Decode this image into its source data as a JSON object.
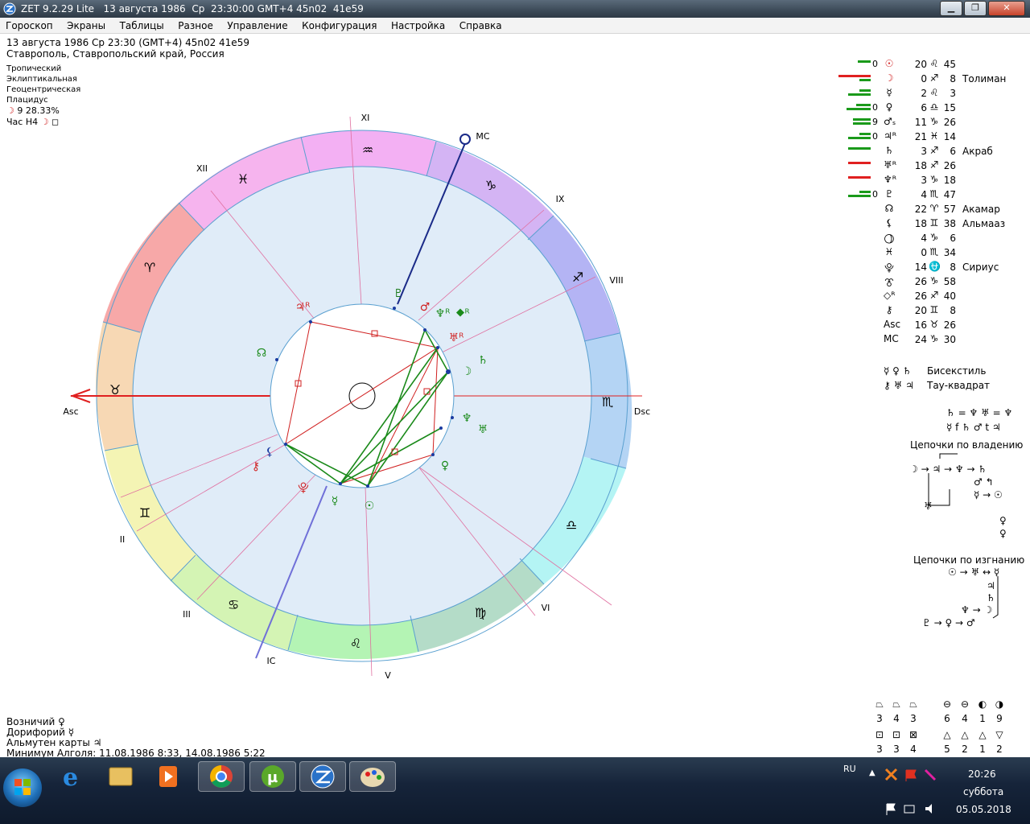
{
  "window": {
    "title": "ZET 9.2.29 Lite   13 августа 1986  Ср  23:30:00 GMT+4 45n02  41e59",
    "buttons": {
      "minimize": "▁",
      "maximize": "❐",
      "close": "✕"
    }
  },
  "menu": [
    "Гороскоп",
    "Экраны",
    "Таблицы",
    "Разное",
    "Управление",
    "Конфигурация",
    "Настройка",
    "Справка"
  ],
  "header": {
    "line1": "13 августа 1986  Ср  23:30 (GMT+4) 45n02  41e59",
    "line2": "Ставрополь, Ставропольский край, Россия",
    "zodiac": "Тропический",
    "coords": "Эклиптикальная",
    "center": "Геоцентрическая",
    "houses": "Плацидус",
    "moon_phase_glyph": "☽",
    "moon_phase": "9 28.33%",
    "hour_label": "Час H4",
    "hour_glyph": "☽",
    "hour_box": "◻"
  },
  "chart": {
    "house_labels": [
      "XI",
      "MC",
      "XII",
      "IX",
      "VIII",
      "Asc",
      "Dsc",
      "II",
      "VI",
      "III",
      "IC",
      "V"
    ],
    "signs": [
      "♒",
      "♑",
      "♓",
      "♐",
      "♈",
      "♏",
      "♉",
      "♎",
      "♊",
      "♍",
      "♋",
      "♌"
    ],
    "planets_on_chart": [
      {
        "glyph": "♇",
        "color": "#1a7a1a"
      },
      {
        "glyph": "♂",
        "color": "#d02020"
      },
      {
        "glyph": "♃ᴿ",
        "color": "#d02020"
      },
      {
        "glyph": "♆ᴿ",
        "color": "#1a8a1a"
      },
      {
        "glyph": "⯁ᴿ",
        "color": "#1a8a1a"
      },
      {
        "glyph": "♅ᴿ",
        "color": "#d02020"
      },
      {
        "glyph": "☊",
        "color": "#1a8a1a"
      },
      {
        "glyph": "♄",
        "color": "#1a8a1a"
      },
      {
        "glyph": "☽",
        "color": "#1a8a1a"
      },
      {
        "glyph": "♆",
        "color": "#1a8a1a"
      },
      {
        "glyph": "♅",
        "color": "#1a8a1a"
      },
      {
        "glyph": "♀",
        "color": "#1a8a1a"
      },
      {
        "glyph": "☿",
        "color": "#1a8a1a"
      },
      {
        "glyph": "☉",
        "color": "#1a8a1a"
      },
      {
        "glyph": "⚷",
        "color": "#d02020"
      },
      {
        "glyph": "⚸",
        "color": "#1a3aa0"
      },
      {
        "glyph": "⯓",
        "color": "#d02020"
      }
    ]
  },
  "planets": [
    {
      "digit": "0",
      "glyph": "☉",
      "glyph_color": "#d02020",
      "deg": "20",
      "sign": "♌",
      "min": "45",
      "star": "",
      "bar1": 16,
      "bar2": 0
    },
    {
      "digit": "",
      "glyph": "☽",
      "glyph_color": "#d02020",
      "deg": "0",
      "sign": "♐",
      "min": "8",
      "star": "Толиман",
      "bar1": 40,
      "bar2": 14
    },
    {
      "digit": "",
      "glyph": "☿",
      "glyph_color": "#000",
      "deg": "2",
      "sign": "♌",
      "min": "3",
      "star": "",
      "bar1": 14,
      "bar2": 28
    },
    {
      "digit": "0",
      "glyph": "♀",
      "glyph_color": "#000",
      "deg": "6",
      "sign": "♎",
      "min": "15",
      "star": "",
      "bar1": 18,
      "bar2": 30
    },
    {
      "digit": "9",
      "glyph": "♂ₛ",
      "glyph_color": "#000",
      "deg": "11",
      "sign": "♑",
      "min": "26",
      "star": "",
      "bar1": 22,
      "bar2": 22
    },
    {
      "digit": "0",
      "glyph": "♃ᴿ",
      "glyph_color": "#000",
      "deg": "21",
      "sign": "♓",
      "min": "14",
      "star": "",
      "bar1": 14,
      "bar2": 28
    },
    {
      "digit": "",
      "glyph": "♄",
      "glyph_color": "#000",
      "deg": "3",
      "sign": "♐",
      "min": "6",
      "star": "Акраб",
      "bar1": 28,
      "bar2": 0
    },
    {
      "digit": "",
      "glyph": "♅ᴿ",
      "glyph_color": "#000",
      "deg": "18",
      "sign": "♐",
      "min": "26",
      "star": "",
      "bar1": 28,
      "bar2": 0
    },
    {
      "digit": "",
      "glyph": "♆ᴿ",
      "glyph_color": "#000",
      "deg": "3",
      "sign": "♑",
      "min": "18",
      "star": "",
      "bar1": 28,
      "bar2": 0
    },
    {
      "digit": "0",
      "glyph": "♇",
      "glyph_color": "#000",
      "deg": "4",
      "sign": "♏",
      "min": "47",
      "star": "",
      "bar1": 14,
      "bar2": 28
    },
    {
      "digit": "",
      "glyph": "☊",
      "glyph_color": "#000",
      "deg": "22",
      "sign": "♈",
      "min": "57",
      "star": "Акамар",
      "bar1": 0,
      "bar2": 0
    },
    {
      "digit": "",
      "glyph": "⚸",
      "glyph_color": "#000",
      "deg": "18",
      "sign": "♊",
      "min": "38",
      "star": "Альмааз",
      "bar1": 0,
      "bar2": 0
    },
    {
      "digit": "",
      "glyph": "⯖",
      "glyph_color": "#000",
      "deg": "4",
      "sign": "♑",
      "min": "6",
      "star": "",
      "bar1": 0,
      "bar2": 0
    },
    {
      "digit": "",
      "glyph": "♓︎",
      "glyph_color": "#000",
      "deg": "0",
      "sign": "♏",
      "min": "34",
      "star": "",
      "bar1": 0,
      "bar2": 0
    },
    {
      "digit": "",
      "glyph": "⯓",
      "glyph_color": "#000",
      "deg": "14",
      "sign": "⛎",
      "min": "8",
      "star": "Сириус",
      "bar1": 0,
      "bar2": 0
    },
    {
      "digit": "",
      "glyph": "⯔",
      "glyph_color": "#000",
      "deg": "26",
      "sign": "♑",
      "min": "58",
      "star": "",
      "bar1": 0,
      "bar2": 0
    },
    {
      "digit": "",
      "glyph": "◇ᴿ",
      "glyph_color": "#000",
      "deg": "26",
      "sign": "♐",
      "min": "40",
      "star": "",
      "bar1": 0,
      "bar2": 0
    },
    {
      "digit": "",
      "glyph": "⚷",
      "glyph_color": "#000",
      "deg": "20",
      "sign": "♊",
      "min": "8",
      "star": "",
      "bar1": 0,
      "bar2": 0
    },
    {
      "digit": "",
      "glyph": "Asc",
      "glyph_color": "#000",
      "deg": "16",
      "sign": "♉",
      "min": "26",
      "star": "",
      "bar1": 0,
      "bar2": 0
    },
    {
      "digit": "",
      "glyph": "MC",
      "glyph_color": "#000",
      "deg": "24",
      "sign": "♑",
      "min": "30",
      "star": "",
      "bar1": 0,
      "bar2": 0
    }
  ],
  "aspects": [
    {
      "glyphs": "☿ ♀ ♄",
      "label": "Бисекстиль"
    },
    {
      "glyphs": "⚷ ♅ ♃",
      "label": "Тау-квадрат"
    }
  ],
  "right_misc": {
    "eq1": "♄ = ♆ ♅ = ♆",
    "eq2": "☿ f ♄ ♂ t ♃",
    "chains_rule": "Цепочки по владению",
    "rule_line1": "☽ → ♃ → ♆ → ♄",
    "rule_line2": "♂ ↰",
    "rule_line3": "☿ → ☉",
    "rule_line4": "♅",
    "rule_line5": "♀",
    "rule_line6": "♀",
    "chains_exile": "Цепочки по изгнанию",
    "exile_line1": "☉ → ♅ ↔ ☿",
    "exile_line2": "♃",
    "exile_line3": "♄",
    "exile_line4": "♆ → ☽",
    "exile_line5": "♇ → ♀ → ♂"
  },
  "shape_counts": {
    "row1_glyphs": [
      "⏢",
      "⏢",
      "⏢",
      "⊖",
      "⊖",
      "◐",
      "◑"
    ],
    "row1_values": [
      "3",
      "4",
      "3",
      "6",
      "4",
      "1",
      "9"
    ],
    "row2_glyphs": [
      "⊡",
      "⊡",
      "⊠",
      "△",
      "△",
      "△",
      "▽"
    ],
    "row2_values": [
      "3",
      "3",
      "4",
      "5",
      "2",
      "1",
      "2"
    ]
  },
  "bottom": {
    "line1": "Возничий  ♀",
    "line2": "Дорифорий  ☿",
    "line3": "Альмутен карты  ♃",
    "line4": "Минимум Алголя: 11.08.1986  8:33,  14.08.1986  5:22"
  },
  "taskbar": {
    "lang": "RU",
    "time": "20:26",
    "day": "суббота",
    "date": "05.05.2018"
  }
}
